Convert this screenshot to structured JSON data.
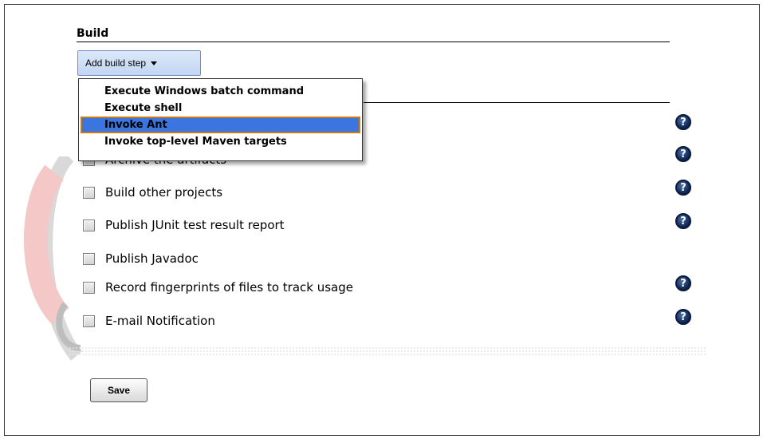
{
  "build": {
    "title": "Build",
    "add_step_label": "Add build step",
    "menu": [
      {
        "label": "Execute Windows batch command",
        "selected": false
      },
      {
        "label": "Execute shell",
        "selected": false
      },
      {
        "label": "Invoke Ant",
        "selected": true
      },
      {
        "label": "Invoke top-level Maven targets",
        "selected": false
      }
    ]
  },
  "post_build": {
    "items": [
      {
        "label": "Archive the artifacts",
        "checked": false
      },
      {
        "label": "Build other projects",
        "checked": false
      },
      {
        "label": "Publish JUnit test result report",
        "checked": false
      },
      {
        "label": "Publish Javadoc",
        "checked": false
      },
      {
        "label": "Record fingerprints of files to track usage",
        "checked": false
      },
      {
        "label": "E-mail Notification",
        "checked": false
      }
    ],
    "help_glyph": "?"
  },
  "actions": {
    "save_label": "Save"
  },
  "icons": {
    "help": "help-icon",
    "caret": "caret-down-icon"
  },
  "colors": {
    "selected_bg": "#3b76e0",
    "selected_border": "#c87a17",
    "button_bg": "#c2d6f2",
    "help_bg": "#0d2350"
  }
}
